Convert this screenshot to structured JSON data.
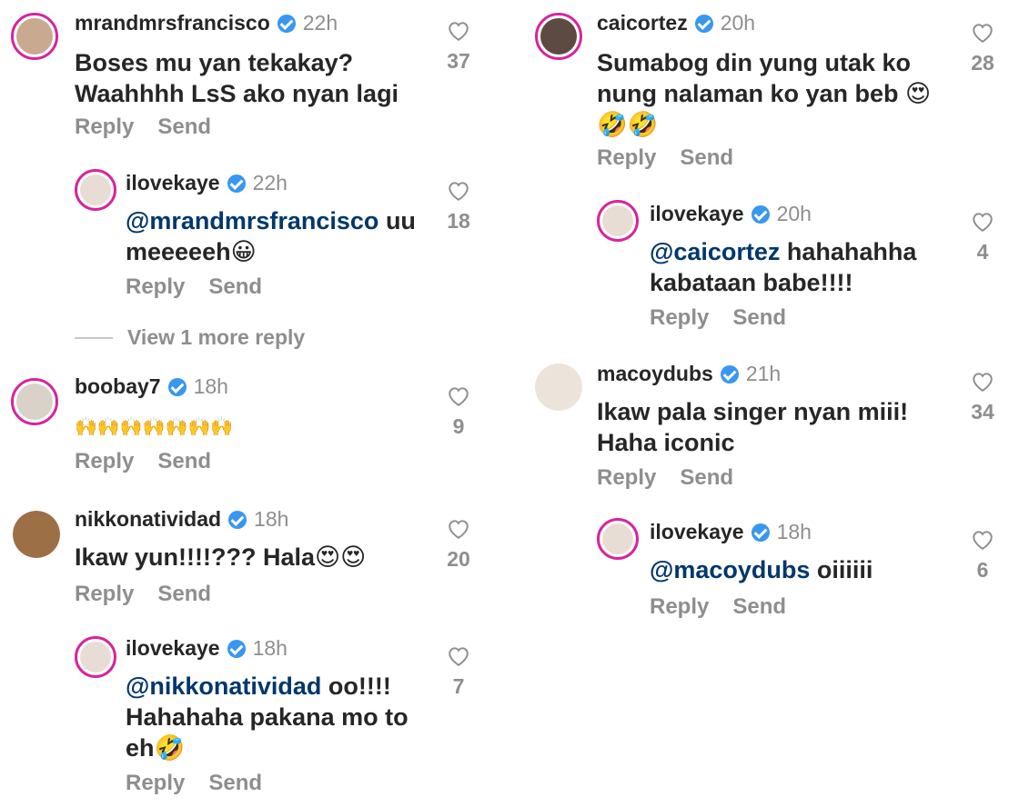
{
  "action_reply": "Reply",
  "action_send": "Send",
  "view_more": "View 1 more reply",
  "left": [
    {
      "username": "mrandmrsfrancisco",
      "time": "22h",
      "text": "Boses mu yan tekakay? Waahhhh LsS ako nyan lagi",
      "likes": "37"
    },
    {
      "username": "ilovekaye",
      "time": "22h",
      "mention": "@mrandmrsfrancisco",
      "text": " uu meeeeeh😀",
      "likes": "18"
    },
    {
      "username": "boobay7",
      "time": "18h",
      "text": "🙌🙌🙌🙌🙌🙌🙌",
      "likes": "9"
    },
    {
      "username": "nikkonatividad",
      "time": "18h",
      "text": "Ikaw yun!!!!??? Hala😍😍",
      "likes": "20"
    },
    {
      "username": "ilovekaye",
      "time": "18h",
      "mention": "@nikkonatividad",
      "text": " oo!!!! Hahahaha pakana mo to eh🤣",
      "likes": "7"
    }
  ],
  "right": [
    {
      "username": "caicortez",
      "time": "20h",
      "text": "Sumabog din yung utak ko nung nalaman ko yan beb 😍🤣🤣",
      "likes": "28"
    },
    {
      "username": "ilovekaye",
      "time": "20h",
      "mention": "@caicortez",
      "text": " hahahahha kabataan babe!!!!",
      "likes": "4"
    },
    {
      "username": "macoydubs",
      "time": "21h",
      "text": "Ikaw pala singer nyan miii! Haha iconic",
      "likes": "34"
    },
    {
      "username": "ilovekaye",
      "time": "18h",
      "mention": "@macoydubs",
      "text": "  oiiiiii",
      "likes": "6"
    }
  ],
  "colors": {
    "text": "#262626",
    "muted": "#8e8e8e",
    "mention": "#00376b",
    "verified": "#3897f0",
    "story_ring": "#d6249f"
  }
}
